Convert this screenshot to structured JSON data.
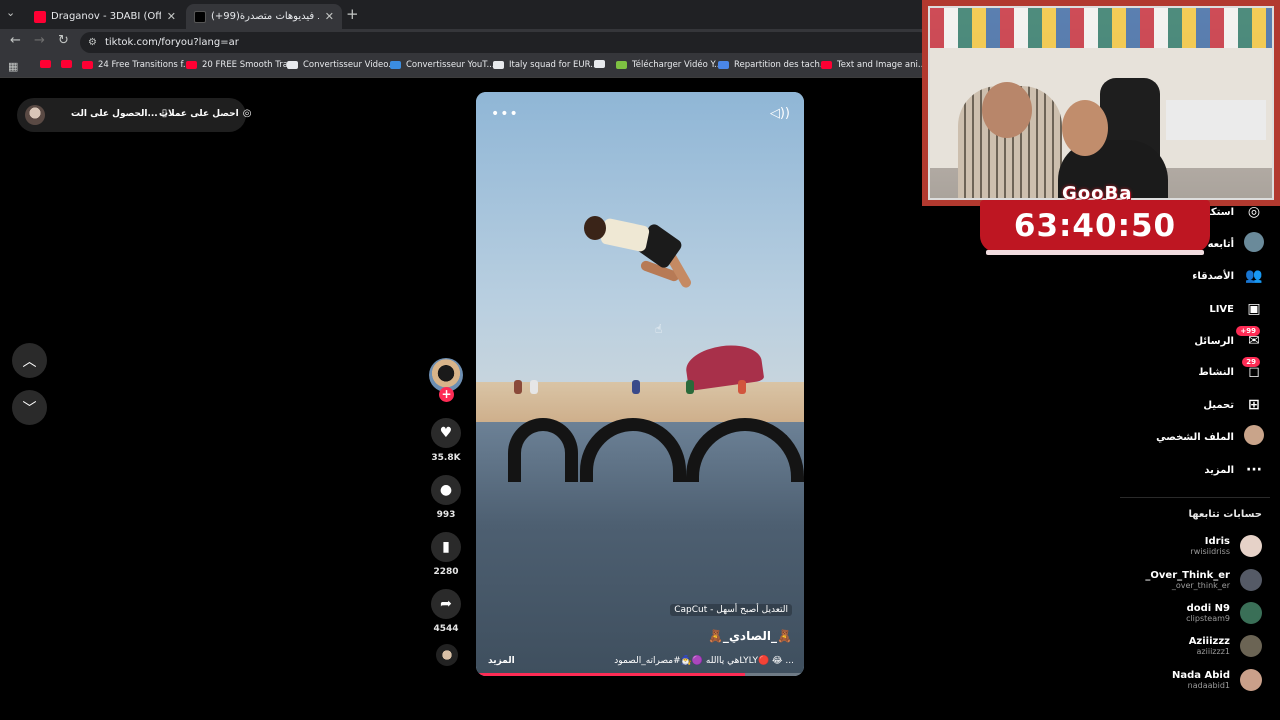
{
  "browser": {
    "tabs": [
      {
        "title": "Draganov - 3DABI (Official Mus",
        "active": false,
        "favicon_color": "#ff0033"
      },
      {
        "title": "(+99)شاهد فيديوهات متصدرة | ",
        "active": true,
        "favicon_color": "#000000"
      }
    ],
    "url": "tiktok.com/foryou?lang=ar",
    "bookmarks": [
      {
        "label": "",
        "color": "#ff0033"
      },
      {
        "label": "",
        "color": "#ff0033"
      },
      {
        "label": "24 Free Transitions f...",
        "color": "#ff0033"
      },
      {
        "label": "20 FREE Smooth Tra...",
        "color": "#ff0033"
      },
      {
        "label": "Convertisseur Video...",
        "color": "#e8eaed"
      },
      {
        "label": "Convertisseur YouT...",
        "color": "#3b8de0"
      },
      {
        "label": "Italy squad for EUR...",
        "color": "#e8eaed"
      },
      {
        "label": "",
        "color": "#e8eaed"
      },
      {
        "label": "Télécharger Vidéo Y...",
        "color": "#7ec142"
      },
      {
        "label": "Repartition des tach...",
        "color": "#4a86e8"
      },
      {
        "label": "Text and Image ani...",
        "color": "#ff0033"
      }
    ]
  },
  "top_bar": {
    "get_app": "الحصول على الت...",
    "get_coins": "احصل على عملات"
  },
  "video": {
    "capcut_label": "CapCut - التعديل أصبح أسهل",
    "author": "🧸_الصادي_🧸",
    "caption": "هي ياالله 🟣🧙‍♂️#مصراته_الصمودLYLY🔴 😂 ...",
    "more": "المزيد",
    "progress": 0.82
  },
  "actions": {
    "likes": "35.8K",
    "comments": "993",
    "saves": "2280",
    "shares": "4544"
  },
  "overlay": {
    "gooba": "GooBa",
    "timer": "63:40:50"
  },
  "sidebar": {
    "items": [
      {
        "label": "استكشف",
        "icon": "compass-icon",
        "glyph": "◎"
      },
      {
        "label": "أتابعه",
        "icon": "following-avatar",
        "glyph": ""
      },
      {
        "label": "الأصدقاء",
        "icon": "friends-icon",
        "glyph": "👥"
      },
      {
        "label": "LIVE",
        "icon": "live-icon",
        "glyph": "▣"
      },
      {
        "label": "الرسائل",
        "icon": "messages-icon",
        "glyph": "✉",
        "badge": "+99"
      },
      {
        "label": "النشاط",
        "icon": "activity-icon",
        "glyph": "◻",
        "badge": "29"
      },
      {
        "label": "تحميل",
        "icon": "upload-icon",
        "glyph": "⊞"
      },
      {
        "label": "الملف الشخصي",
        "icon": "profile-avatar",
        "glyph": ""
      },
      {
        "label": "المزيد",
        "icon": "more-icon",
        "glyph": "···"
      }
    ],
    "following_title": "حسابات تتابعها",
    "accounts": [
      {
        "name": "Idris",
        "handle": "rwisiidriss",
        "color": "#e6d2c8"
      },
      {
        "name": "_Over_Think_er",
        "handle": "_over_think_er",
        "color": "#555a66"
      },
      {
        "name": "dodi N9",
        "handle": "clipsteam9",
        "color": "#3a6f57"
      },
      {
        "name": "Aziiizzz",
        "handle": "aziiizzz1",
        "color": "#6b6454"
      },
      {
        "name": "Nada Abid",
        "handle": "nadaabid1",
        "color": "#caa08a"
      }
    ]
  }
}
